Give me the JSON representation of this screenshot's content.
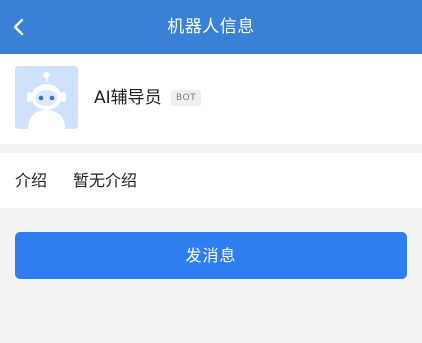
{
  "header": {
    "title": "机器人信息",
    "back_icon": "chevron-left-icon"
  },
  "profile": {
    "name": "AI辅导员",
    "badge": "BOT",
    "avatar_icon": "robot-avatar-icon"
  },
  "intro": {
    "label": "介绍",
    "value": "暂无介绍"
  },
  "actions": {
    "send_label": "发消息"
  },
  "colors": {
    "header_bg": "#3a80d7",
    "button_bg": "#2f7ef0",
    "page_bg": "#f3f3f3"
  }
}
